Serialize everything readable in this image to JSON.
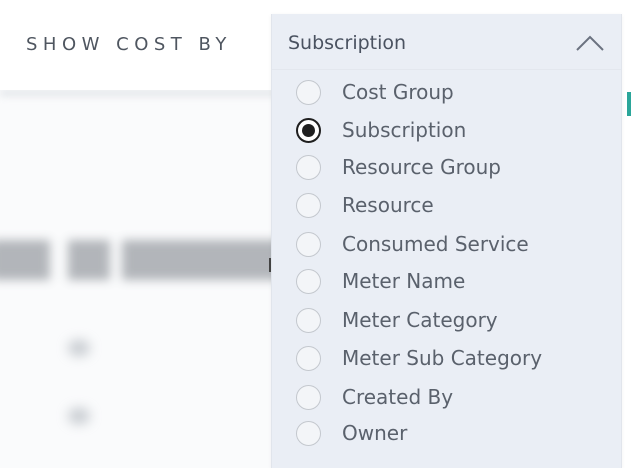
{
  "header": {
    "label": "SHOW COST BY"
  },
  "dropdown": {
    "selected_value": "Subscription",
    "expanded": true,
    "options": [
      {
        "label": "Cost Group",
        "checked": false
      },
      {
        "label": "Subscription",
        "checked": true
      },
      {
        "label": "Resource Group",
        "checked": false
      },
      {
        "label": "Resource",
        "checked": false
      },
      {
        "label": "Consumed Service",
        "checked": false
      },
      {
        "label": "Meter Name",
        "checked": false
      },
      {
        "label": "Meter Category",
        "checked": false
      },
      {
        "label": "Meter Sub Category",
        "checked": false
      },
      {
        "label": "Created By",
        "checked": false
      },
      {
        "label": "Owner",
        "checked": false
      }
    ]
  },
  "icons": {
    "toggle": "chevron-up-icon",
    "radio_checked": "radio-checked-icon",
    "radio_unchecked": "radio-unchecked-icon"
  },
  "colors": {
    "dropdown_bg": "#eaeef5",
    "text": "#5a616c",
    "radio_checked": "#1f1f1f",
    "accent": "#2ba69a"
  }
}
